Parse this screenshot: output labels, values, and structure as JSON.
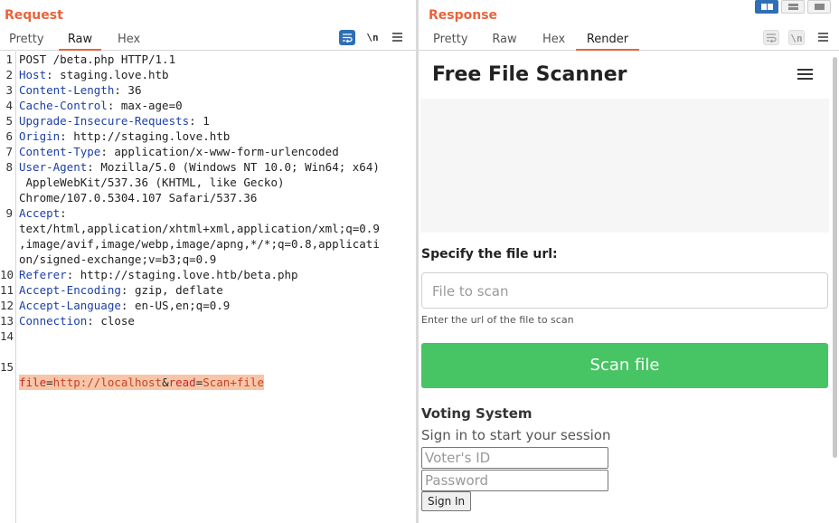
{
  "request": {
    "title": "Request",
    "tabs": [
      "Pretty",
      "Raw",
      "Hex"
    ],
    "active_tab": "Raw",
    "tools": {
      "wrap_icon": "wrap-lines-icon",
      "newline_label": "\\n",
      "menu_icon": "menu-icon"
    },
    "lines": [
      {
        "n": "1",
        "key": "",
        "sep": "",
        "val": "POST /beta.php HTTP/1.1"
      },
      {
        "n": "2",
        "key": "Host",
        "sep": ": ",
        "val": "staging.love.htb"
      },
      {
        "n": "3",
        "key": "Content-Length",
        "sep": ": ",
        "val": "36"
      },
      {
        "n": "4",
        "key": "Cache-Control",
        "sep": ": ",
        "val": "max-age=0"
      },
      {
        "n": "5",
        "key": "Upgrade-Insecure-Requests",
        "sep": ": ",
        "val": "1"
      },
      {
        "n": "6",
        "key": "Origin",
        "sep": ": ",
        "val": "http://staging.love.htb"
      },
      {
        "n": "7",
        "key": "Content-Type",
        "sep": ": ",
        "val": "application/x-www-form-urlencoded"
      },
      {
        "n": "8",
        "key": "User-Agent",
        "sep": ": ",
        "val": "Mozilla/5.0 (Windows NT 10.0; Win64; x64)"
      },
      {
        "n": "",
        "key": "",
        "sep": "",
        "val": " AppleWebKit/537.36 (KHTML, like Gecko)"
      },
      {
        "n": "",
        "key": "",
        "sep": "",
        "val": "Chrome/107.0.5304.107 Safari/537.36"
      },
      {
        "n": "9",
        "key": "Accept",
        "sep": ":",
        "val": ""
      },
      {
        "n": "",
        "key": "",
        "sep": "",
        "val": "text/html,application/xhtml+xml,application/xml;q=0.9"
      },
      {
        "n": "",
        "key": "",
        "sep": "",
        "val": ",image/avif,image/webp,image/apng,*/*;q=0.8,applicati"
      },
      {
        "n": "",
        "key": "",
        "sep": "",
        "val": "on/signed-exchange;v=b3;q=0.9"
      },
      {
        "n": "10",
        "key": "Referer",
        "sep": ": ",
        "val": "http://staging.love.htb/beta.php"
      },
      {
        "n": "11",
        "key": "Accept-Encoding",
        "sep": ": ",
        "val": "gzip, deflate"
      },
      {
        "n": "12",
        "key": "Accept-Language",
        "sep": ": ",
        "val": "en-US,en;q=0.9"
      },
      {
        "n": "13",
        "key": "Connection",
        "sep": ": ",
        "val": "close"
      },
      {
        "n": "14",
        "key": "",
        "sep": "",
        "val": ""
      }
    ],
    "body_line": {
      "n": "15",
      "k1": "file",
      "eq1": "=",
      "v1": "http://localhost",
      "amp": "&",
      "k2": "read",
      "eq2": "=",
      "v2": "Scan+file"
    }
  },
  "response": {
    "title": "Response",
    "tabs": [
      "Pretty",
      "Raw",
      "Hex",
      "Render"
    ],
    "active_tab": "Render",
    "tools": {
      "wrap_icon": "wrap-lines-icon",
      "newline_label": "\\n",
      "menu_icon": "menu-icon"
    },
    "render": {
      "page_title": "Free File Scanner",
      "url_label": "Specify the file url:",
      "url_placeholder": "File to scan",
      "url_help": "Enter the url of the file to scan",
      "scan_button": "Scan file",
      "voting_title": "Voting System",
      "voting_subtitle": "Sign in to start your session",
      "voter_id_placeholder": "Voter's ID",
      "password_placeholder": "Password",
      "sign_in_button": "Sign In"
    }
  },
  "colors": {
    "accent": "#e8643c",
    "tool_blue": "#2f6fb5",
    "scan_green": "#47c463",
    "header_key": "#1c3fa8"
  }
}
